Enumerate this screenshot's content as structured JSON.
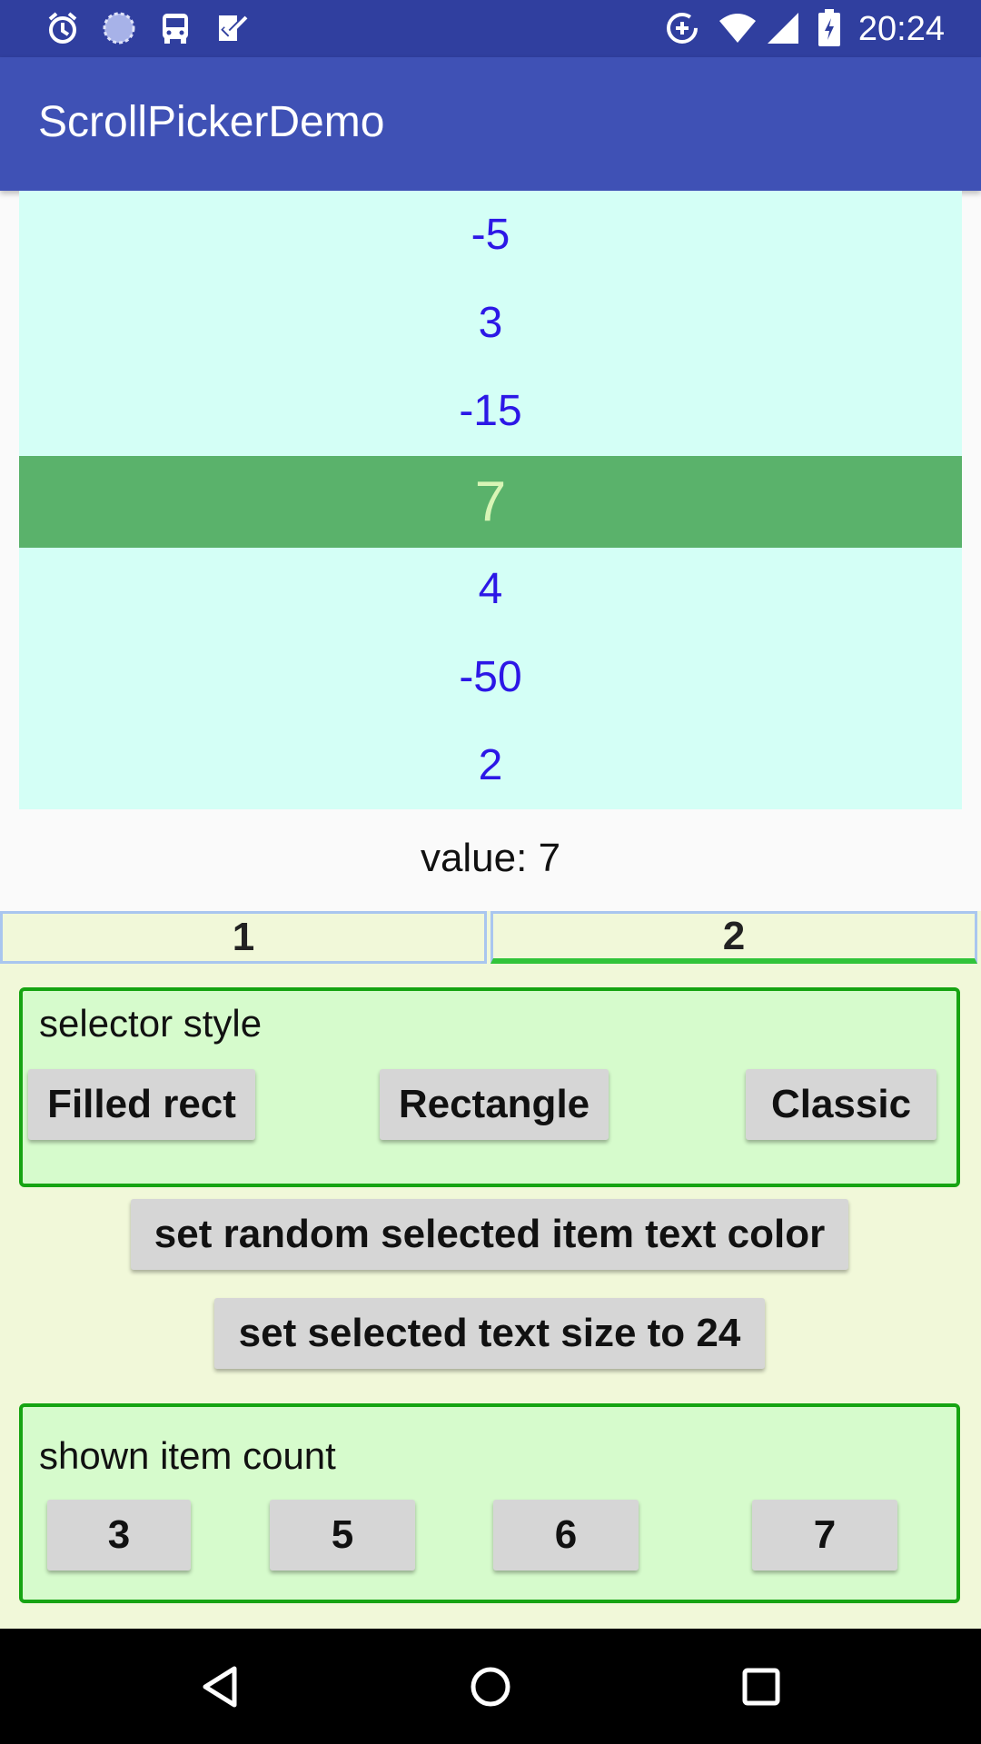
{
  "status_bar": {
    "time": "20:24",
    "icons_left": [
      "alarm-icon",
      "sync-icon",
      "bus-icon",
      "checkbox-icon"
    ],
    "icons_right": [
      "data-saver-icon",
      "wifi-icon",
      "signal-icon",
      "battery-icon"
    ]
  },
  "app": {
    "title": "ScrollPickerDemo"
  },
  "picker": {
    "items": [
      "-5",
      "3",
      "-15",
      "7",
      "4",
      "-50",
      "2"
    ],
    "selected_index": 3,
    "colors": {
      "background": "#d4fff6",
      "item_text": "#2c17e6",
      "selected_bg": "#5ab26b",
      "selected_text": "#d8f5b6"
    }
  },
  "value_label": "value: 7",
  "tabs": [
    {
      "label": "1"
    },
    {
      "label": "2"
    }
  ],
  "active_tab": 1,
  "selector_style": {
    "title": "selector style",
    "buttons": [
      "Filled rect",
      "Rectangle",
      "Classic"
    ]
  },
  "actions": {
    "random_color": "set random selected item text color",
    "text_size": "set selected text size to 24"
  },
  "item_count": {
    "title": "shown item count",
    "buttons": [
      "3",
      "5",
      "6",
      "7"
    ]
  },
  "colors": {
    "status_bar": "#303f9f",
    "app_bar": "#3f51b5",
    "group_border": "#16a412",
    "group_bg": "#d6fbcc",
    "lower_bg": "#f1f8d9"
  }
}
